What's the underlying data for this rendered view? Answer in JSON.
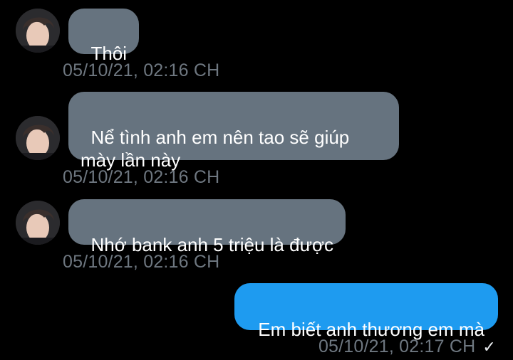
{
  "conversation": {
    "messages": [
      {
        "text": "Thôi",
        "time": "05/10/21, 02:16 CH"
      },
      {
        "text": "Nể tình anh em nên tao sẽ giúp mày lần này",
        "time": "05/10/21, 02:16 CH"
      },
      {
        "text": "Nhớ bank anh 5 triệu là được",
        "time": "05/10/21, 02:16 CH"
      },
      {
        "text": "Em biết anh thương em mà",
        "time": "05/10/21, 02:17 CH",
        "status_icon": "checkmark-icon"
      }
    ]
  },
  "colors": {
    "background": "#000000",
    "incoming_bubble": "#66737f",
    "outgoing_bubble": "#1e9bf0",
    "timestamp": "#6e7780"
  }
}
